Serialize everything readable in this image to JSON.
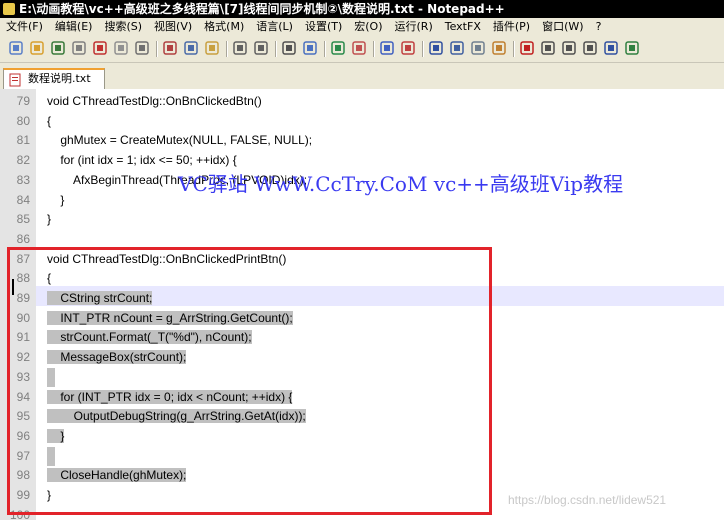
{
  "window": {
    "title": "E:\\动画教程\\vc++高级班之多线程篇\\[7]线程间同步机制②\\数程说明.txt - Notepad++"
  },
  "menu": [
    "文件(F)",
    "编辑(E)",
    "搜索(S)",
    "视图(V)",
    "格式(M)",
    "语言(L)",
    "设置(T)",
    "宏(O)",
    "运行(R)",
    "TextFX",
    "插件(P)",
    "窗口(W)",
    "?"
  ],
  "tab": {
    "label": "数程说明.txt"
  },
  "lines": [
    {
      "num": "79",
      "text": "void CThreadTestDlg::OnBnClickedBtn()",
      "sel": false
    },
    {
      "num": "80",
      "text": "{",
      "sel": false
    },
    {
      "num": "81",
      "text": "    ghMutex = CreateMutex(NULL, FALSE, NULL);",
      "sel": false
    },
    {
      "num": "82",
      "text": "    for (int idx = 1; idx <= 50; ++idx) {",
      "sel": false
    },
    {
      "num": "83",
      "text": "        AfxBeginThread(ThreadProc, (LPVOID)idx);",
      "sel": false
    },
    {
      "num": "84",
      "text": "    }",
      "sel": false
    },
    {
      "num": "85",
      "text": "}",
      "sel": false
    },
    {
      "num": "86",
      "text": "",
      "sel": false
    },
    {
      "num": "87",
      "text": "void CThreadTestDlg::OnBnClickedPrintBtn()",
      "sel": false
    },
    {
      "num": "88",
      "text": "{",
      "sel": false
    },
    {
      "num": "89",
      "text": "    CString strCount;",
      "sel": true
    },
    {
      "num": "90",
      "text": "    INT_PTR nCount = g_ArrString.GetCount();",
      "sel": true
    },
    {
      "num": "91",
      "text": "    strCount.Format(_T(\"%d\"), nCount);",
      "sel": true
    },
    {
      "num": "92",
      "text": "    MessageBox(strCount);",
      "sel": true
    },
    {
      "num": "93",
      "text": "",
      "sel": true
    },
    {
      "num": "94",
      "text": "    for (INT_PTR idx = 0; idx < nCount; ++idx) {",
      "sel": true
    },
    {
      "num": "95",
      "text": "        OutputDebugString(g_ArrString.GetAt(idx));",
      "sel": true
    },
    {
      "num": "96",
      "text": "    }",
      "sel": true
    },
    {
      "num": "97",
      "text": "",
      "sel": true
    },
    {
      "num": "98",
      "text": "    CloseHandle(ghMutex);",
      "sel": true
    },
    {
      "num": "99",
      "text": "}",
      "sel": false
    },
    {
      "num": "100",
      "text": "",
      "sel": false
    }
  ],
  "watermark": "VC驿站 WwW.CcTry.CoM vc++高级班Vip教程",
  "credit": "https://blog.csdn.net/lidew521",
  "colors": {
    "highlight_box": "#e2232a",
    "selection": "#c0c0c0",
    "watermark": "#3a3af0"
  },
  "toolbar_icons": [
    "new-icon",
    "open-icon",
    "save-icon",
    "save-all-icon",
    "close-icon",
    "close-all-icon",
    "print-icon",
    "cut-icon",
    "copy-icon",
    "paste-icon",
    "undo-icon",
    "redo-icon",
    "find-icon",
    "replace-icon",
    "zoom-in-icon",
    "zoom-out-icon",
    "sync-v-icon",
    "sync-h-icon",
    "wrap-icon",
    "show-all-chars-icon",
    "indent-guide-icon",
    "user-lang-icon",
    "record-macro-icon",
    "stop-macro-icon",
    "play-macro-icon",
    "play-multi-icon",
    "save-macro-icon",
    "trim-icon"
  ]
}
